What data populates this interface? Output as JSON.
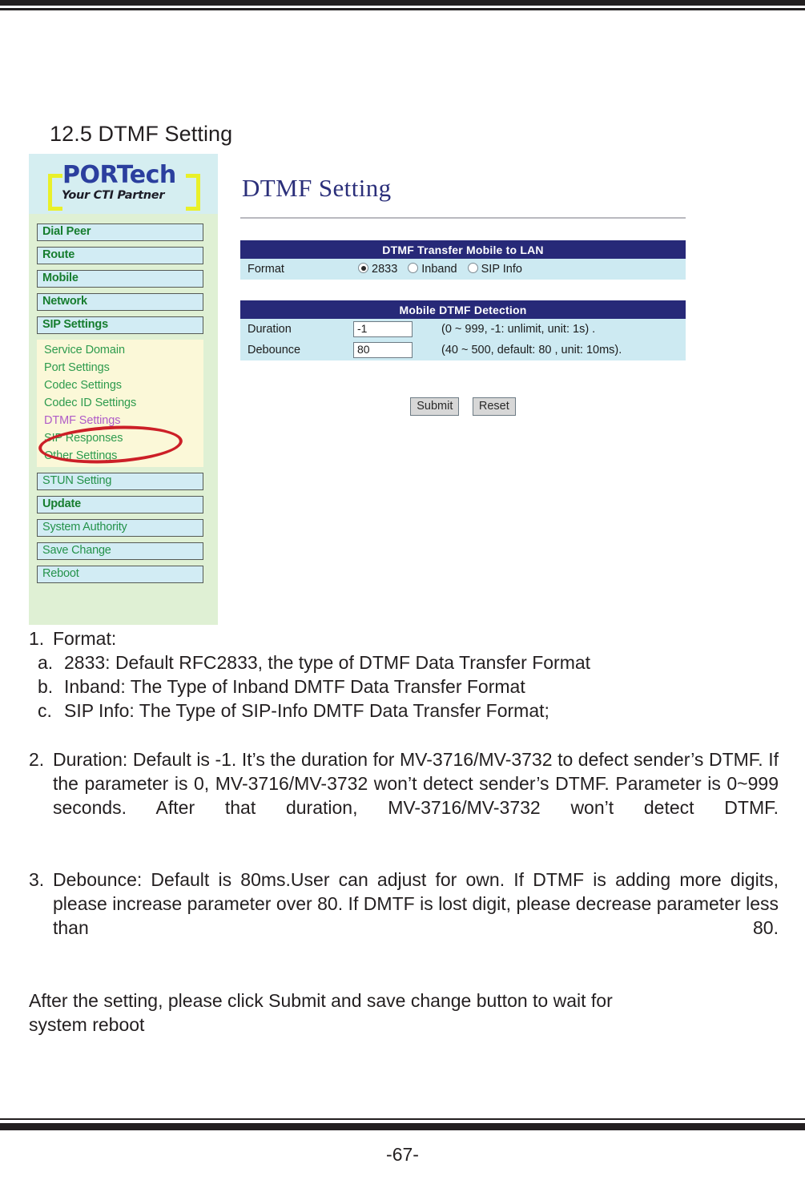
{
  "page": {
    "section_number": "12.5",
    "section_title": "DTMF Setting",
    "heading": "12.5 DTMF Setting",
    "page_number": "-67-"
  },
  "screenshot": {
    "logo": {
      "brand": "PORTech",
      "tagline": "Your CTI Partner"
    },
    "sidebar": {
      "top_items": [
        {
          "label": "Dial Peer",
          "style": "bold"
        },
        {
          "label": "Route",
          "style": "bold"
        },
        {
          "label": "Mobile",
          "style": "bold"
        },
        {
          "label": "Network",
          "style": "bold"
        },
        {
          "label": "SIP Settings",
          "style": "bold"
        }
      ],
      "sub_items": [
        {
          "label": "Service Domain",
          "state": "normal"
        },
        {
          "label": "Port Settings",
          "state": "normal"
        },
        {
          "label": "Codec Settings",
          "state": "normal"
        },
        {
          "label": "Codec ID Settings",
          "state": "normal"
        },
        {
          "label": "DTMF Settings",
          "state": "visited-circled"
        },
        {
          "label": "SIP Responses",
          "state": "normal"
        },
        {
          "label": "Other Settings",
          "state": "normal"
        }
      ],
      "bottom_items": [
        {
          "label": "STUN Setting",
          "style": "thin"
        },
        {
          "label": "Update",
          "style": "bold"
        },
        {
          "label": "System Authority",
          "style": "thin"
        },
        {
          "label": "Save Change",
          "style": "thin"
        },
        {
          "label": "Reboot",
          "style": "thin"
        }
      ]
    },
    "main": {
      "title": "DTMF Setting",
      "transfer_table": {
        "header": "DTMF Transfer Mobile to LAN",
        "row_label": "Format",
        "options": [
          {
            "label": "2833",
            "selected": true
          },
          {
            "label": "Inband",
            "selected": false
          },
          {
            "label": "SIP Info",
            "selected": false
          }
        ]
      },
      "detection_table": {
        "header": "Mobile DTMF Detection",
        "rows": [
          {
            "label": "Duration",
            "value": "-1",
            "hint": "(0 ~ 999, -1: unlimit, unit: 1s) ."
          },
          {
            "label": "Debounce",
            "value": "80",
            "hint": "(40 ~ 500, default: 80 , unit: 10ms)."
          }
        ]
      },
      "buttons": {
        "submit": "Submit",
        "reset": "Reset"
      }
    }
  },
  "notes": {
    "item1": {
      "num": "1.",
      "text": "Format:",
      "subs": [
        {
          "num": "a.",
          "text": "2833: Default RFC2833, the type of DTMF Data Transfer Format"
        },
        {
          "num": "b.",
          "text": "Inband: The Type of Inband DMTF Data Transfer Format"
        },
        {
          "num": "c.",
          "text": "SIP Info: The Type of SIP-Info DMTF Data Transfer Format;"
        }
      ]
    },
    "item2": {
      "num": "2.",
      "text": "Duration: Default is -1. It’s the duration for MV-3716/MV-3732 to defect sender’s DTMF. If the parameter is 0, MV-3716/MV-3732 won’t detect sender’s DTMF. Parameter is 0~999 seconds. After that duration, MV-3716/MV-3732 won’t detect DTMF."
    },
    "item3": {
      "num": "3.",
      "text": "Debounce: Default is 80ms.User can adjust for own. If DTMF is adding more digits, please increase parameter over 80. If DMTF is lost digit, please decrease parameter less than 80."
    },
    "closing_line1": "After the setting, please click Submit and save change button to wait for",
    "closing_line2": "system reboot"
  },
  "colors": {
    "rule": "#231f20",
    "brand_blue": "#2b3f9e",
    "bracket_yellow": "#e9f02a",
    "menu_green": "#167d2e",
    "menu_blue_bg": "#d2ecf4",
    "sidebar_bg": "#dff0d4",
    "submenu_bg": "#fbf8d8",
    "visited_purple": "#b05cc8",
    "annotation_red": "#cc1f27",
    "table_header_navy": "#272978",
    "table_row_blue": "#cdeaf2",
    "page_title_navy": "#2b2f7a"
  }
}
